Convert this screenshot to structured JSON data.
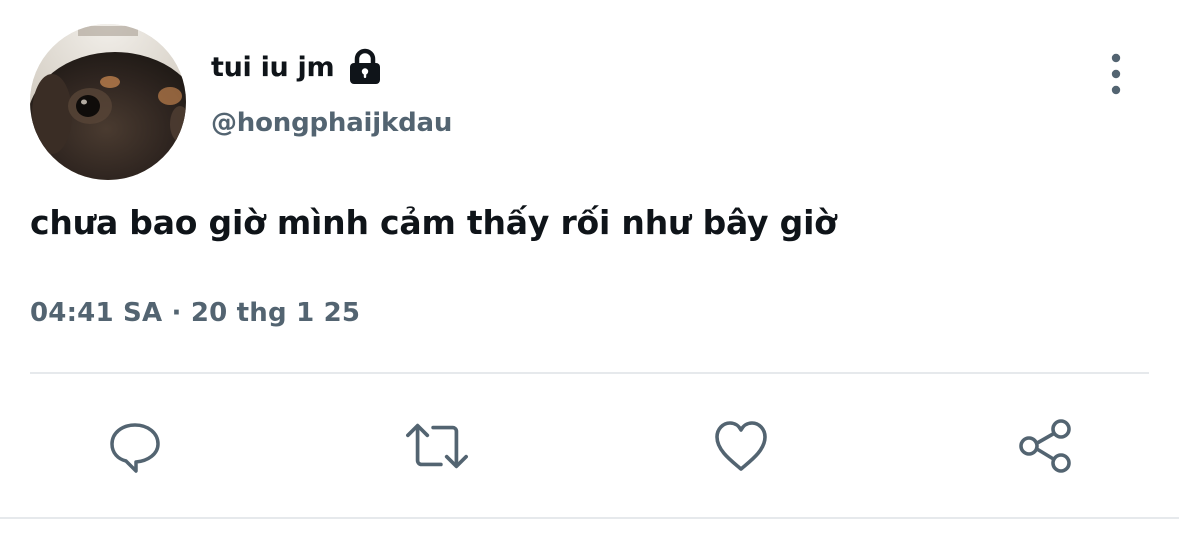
{
  "author": {
    "display_name": "tui iu jm",
    "handle": "@hongphaijkdau",
    "protected_icon": "lock-icon",
    "avatar_icon": "dog-close-up-photo"
  },
  "tweet": {
    "text": "chưa bao giờ mình cảm thấy rối như bây giờ",
    "timestamp": "04:41 SA · 20 thg 1 25"
  },
  "actions": {
    "more_icon": "more-vertical-icon",
    "reply_icon": "reply-icon",
    "retweet_icon": "retweet-icon",
    "like_icon": "heart-icon",
    "share_icon": "share-icon"
  },
  "colors": {
    "primary_text": "#0f1419",
    "secondary_text": "#536471",
    "divider": "#e6e9ec",
    "icon": "#536471"
  }
}
